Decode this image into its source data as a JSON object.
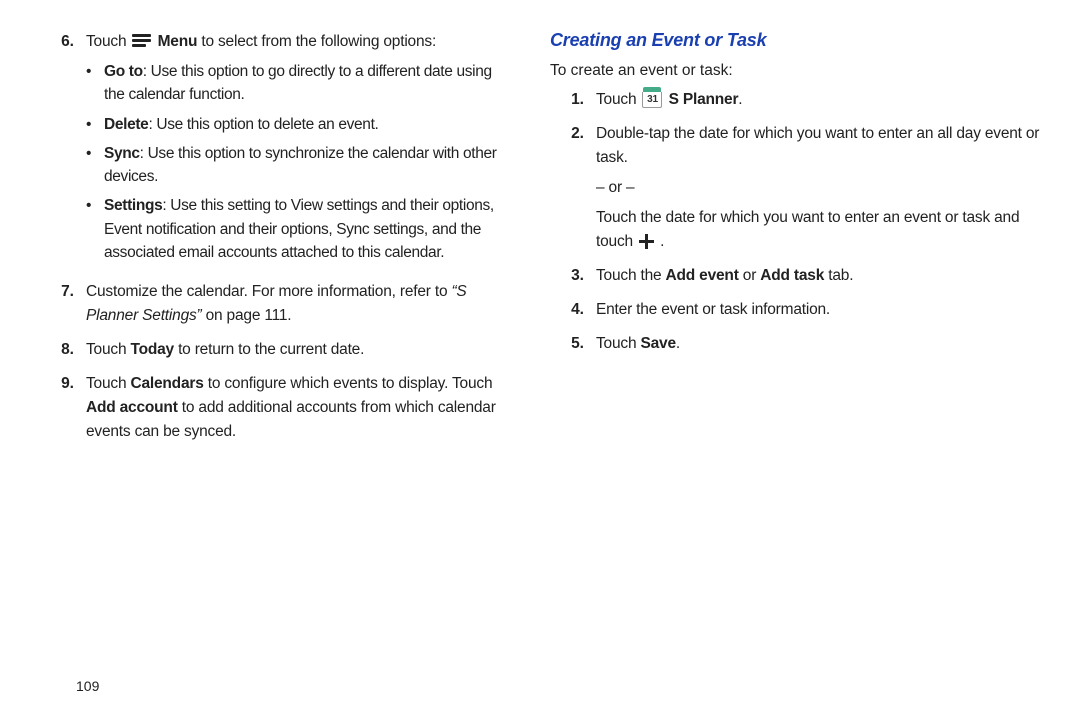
{
  "pageNumber": "109",
  "left": {
    "items": [
      {
        "num": "6.",
        "lead": "Touch ",
        "menuWord": "Menu",
        "tail": " to select from the following options:",
        "subs": [
          {
            "label": "Go to",
            "text": ": Use this option to go directly to a different date using the calendar function."
          },
          {
            "label": "Delete",
            "text": ": Use this option to delete an event."
          },
          {
            "label": "Sync",
            "text": ": Use this option to synchronize the calendar with other devices."
          },
          {
            "label": "Settings",
            "text": ": Use this setting to View settings and their options, Event notification and their options, Sync settings, and the associated email accounts attached to this calendar."
          }
        ]
      },
      {
        "num": "7.",
        "plain1": "Customize the calendar. For more information, refer to ",
        "italic": "“S Planner Settings”",
        "plain2": " on page 111."
      },
      {
        "num": "8.",
        "p1": "Touch ",
        "b1": "Today",
        "p2": " to return to the current date."
      },
      {
        "num": "9.",
        "p1": "Touch ",
        "b1": "Calendars",
        "p2": " to configure which events to display. Touch ",
        "b2": "Add account",
        "p3": " to add additional accounts from which calendar events can be synced."
      }
    ]
  },
  "right": {
    "heading": "Creating an Event or Task",
    "intro": "To create an event or task:",
    "calDay": "31",
    "items": [
      {
        "num": "1.",
        "p1": "Touch ",
        "b1": "S Planner",
        "p2": "."
      },
      {
        "num": "2.",
        "line1": "Double-tap the date for which you want to enter an all day event or task.",
        "or": "– or –",
        "line2a": "Touch the date for which you want to enter an event or task and touch ",
        "line2b": " ."
      },
      {
        "num": "3.",
        "p1": "Touch the ",
        "b1": "Add event",
        "p2": " or ",
        "b2": "Add task",
        "p3": " tab."
      },
      {
        "num": "4.",
        "p1": "Enter the event or task information."
      },
      {
        "num": "5.",
        "p1": "Touch ",
        "b1": "Save",
        "p2": "."
      }
    ]
  }
}
